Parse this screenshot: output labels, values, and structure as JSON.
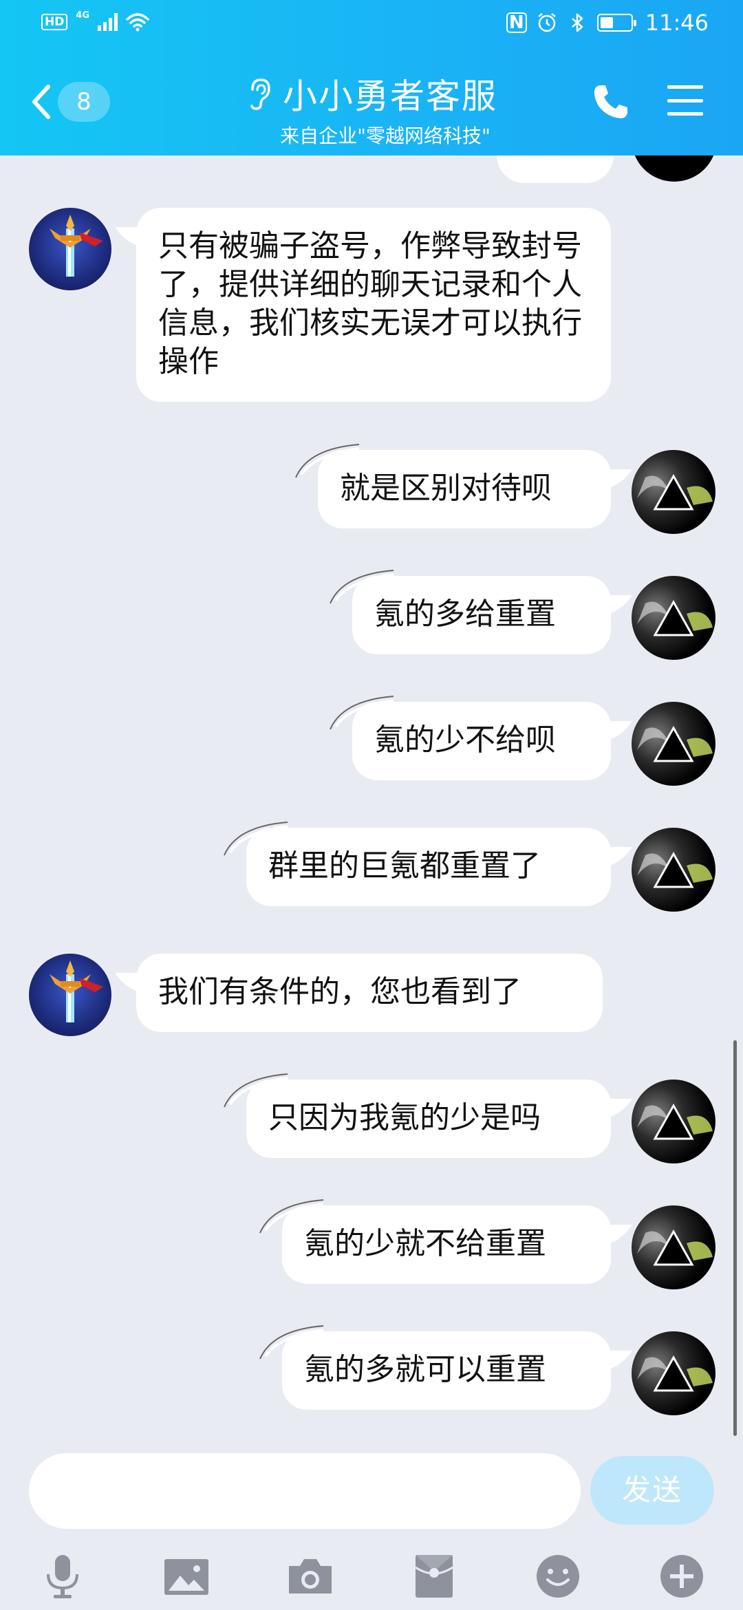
{
  "status_bar": {
    "hd": "HD",
    "network": "4G",
    "time": "11:46",
    "nfc": "N"
  },
  "header": {
    "unread_count": "8",
    "title": "小小勇者客服",
    "subtitle": "来自企业\"零越网络科技\""
  },
  "messages": [
    {
      "side": "left",
      "text": "只有被骗子盗号，作弊导致封号了，提供详细的聊天记录和个人信息，我们核实无误才可以执行操作"
    },
    {
      "side": "right",
      "text": "就是区别对待呗"
    },
    {
      "side": "right",
      "text": "氪的多给重置"
    },
    {
      "side": "right",
      "text": "氪的少不给呗"
    },
    {
      "side": "right",
      "text": "群里的巨氪都重置了"
    },
    {
      "side": "left",
      "text": "我们有条件的，您也看到了"
    },
    {
      "side": "right",
      "text": "只因为我氪的少是吗"
    },
    {
      "side": "right",
      "text": "氪的少就不给重置"
    },
    {
      "side": "right",
      "text": "氪的多就可以重置"
    }
  ],
  "input": {
    "value": "",
    "send_label": "发送"
  },
  "toolbar": {
    "icons": [
      "microphone-icon",
      "image-icon",
      "camera-icon",
      "red-packet-icon",
      "emoji-icon",
      "plus-icon"
    ]
  },
  "colors": {
    "header_start": "#14c6f4",
    "header_end": "#1aa6f4",
    "chat_bg": "#e9ebf2",
    "send_button": "#bfe7fb"
  }
}
